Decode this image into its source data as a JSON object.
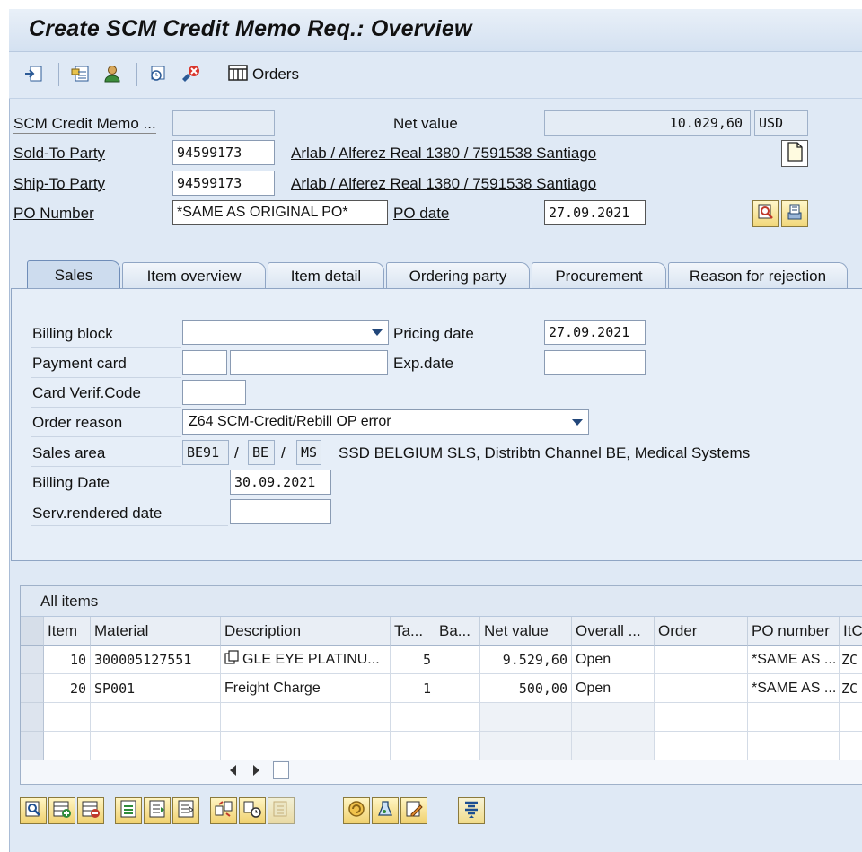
{
  "title": "Create SCM Credit Memo Req.: Overview",
  "toolbar": {
    "orders_label": "Orders",
    "icons": [
      "display-other-document-icon",
      "business-data-header-icon",
      "partner-icon",
      "orders-from-document-icon",
      "cancel-document-icon",
      "orders-grid-icon"
    ]
  },
  "header": {
    "doc_label": "SCM Credit Memo ...",
    "doc_value": "",
    "net_value_label": "Net value",
    "net_value": "10.029,60",
    "currency": "USD",
    "sold_to_label": "Sold-To Party",
    "sold_to_value": "94599173",
    "sold_to_desc": "Arlab / Alferez Real 1380 / 7591538 Santiago",
    "ship_to_label": "Ship-To Party",
    "ship_to_value": "94599173",
    "ship_to_desc": "Arlab / Alferez Real 1380 / 7591538 Santiago",
    "po_number_label": "PO Number",
    "po_number_value": "*SAME AS ORIGINAL PO*",
    "po_date_label": "PO date",
    "po_date_value": "27.09.2021"
  },
  "tabs": [
    {
      "label": "Sales",
      "active": true
    },
    {
      "label": "Item overview"
    },
    {
      "label": "Item detail"
    },
    {
      "label": "Ordering party"
    },
    {
      "label": "Procurement"
    },
    {
      "label": "Reason for rejection"
    }
  ],
  "sales": {
    "billing_block_label": "Billing block",
    "billing_block_value": "",
    "pricing_date_label": "Pricing date",
    "pricing_date_value": "27.09.2021",
    "payment_card_label": "Payment card",
    "payment_card_type": "",
    "payment_card_number": "",
    "exp_date_label": "Exp.date",
    "exp_date_value": "",
    "cvc_label": "Card Verif.Code",
    "cvc_value": "",
    "order_reason_label": "Order reason",
    "order_reason_value": "Z64 SCM-Credit/Rebill OP error",
    "sales_area_label": "Sales area",
    "sales_org": "BE91",
    "dist_channel": "BE",
    "division": "MS",
    "sep": "/",
    "sales_area_desc": "SSD BELGIUM SLS, Distribtn Channel BE, Medical Systems",
    "billing_date_label": "Billing Date",
    "billing_date_value": "30.09.2021",
    "serv_rendered_label": "Serv.rendered date",
    "serv_rendered_value": ""
  },
  "items": {
    "caption": "All items",
    "columns": [
      "Item",
      "Material",
      "Description",
      "Ta...",
      "Ba...",
      "Net value",
      "Overall ...",
      "Order",
      "PO number",
      "ItC"
    ],
    "rows": [
      {
        "item": "10",
        "material": "300005127551",
        "description": "GLE EYE PLATINU...",
        "qty": "5",
        "ba": "",
        "net_value": "9.529,60",
        "status": "Open",
        "order": "",
        "po_number": "*SAME AS ...",
        "itc": "ZC"
      },
      {
        "item": "20",
        "material": "SP001",
        "description": "Freight Charge",
        "qty": "1",
        "ba": "",
        "net_value": "500,00",
        "status": "Open",
        "order": "",
        "po_number": "*SAME AS ...",
        "itc": "ZC"
      }
    ]
  },
  "bottom_toolbar": {
    "icons": [
      "item-details-icon",
      "insert-row-icon",
      "delete-row-icon",
      "select-all-icon",
      "select-block-icon",
      "deselect-all-icon",
      "item-partner-icon",
      "item-conditions-icon",
      "item-copy-icon",
      "availability-icon",
      "configuration-icon",
      "edit-item-icon",
      "item-structure-icon"
    ]
  },
  "colors": {
    "background": "#dfe9f5",
    "panel": "#e6eef8",
    "accent_button": "#f1d77a",
    "icon_blue": "#22477a"
  }
}
